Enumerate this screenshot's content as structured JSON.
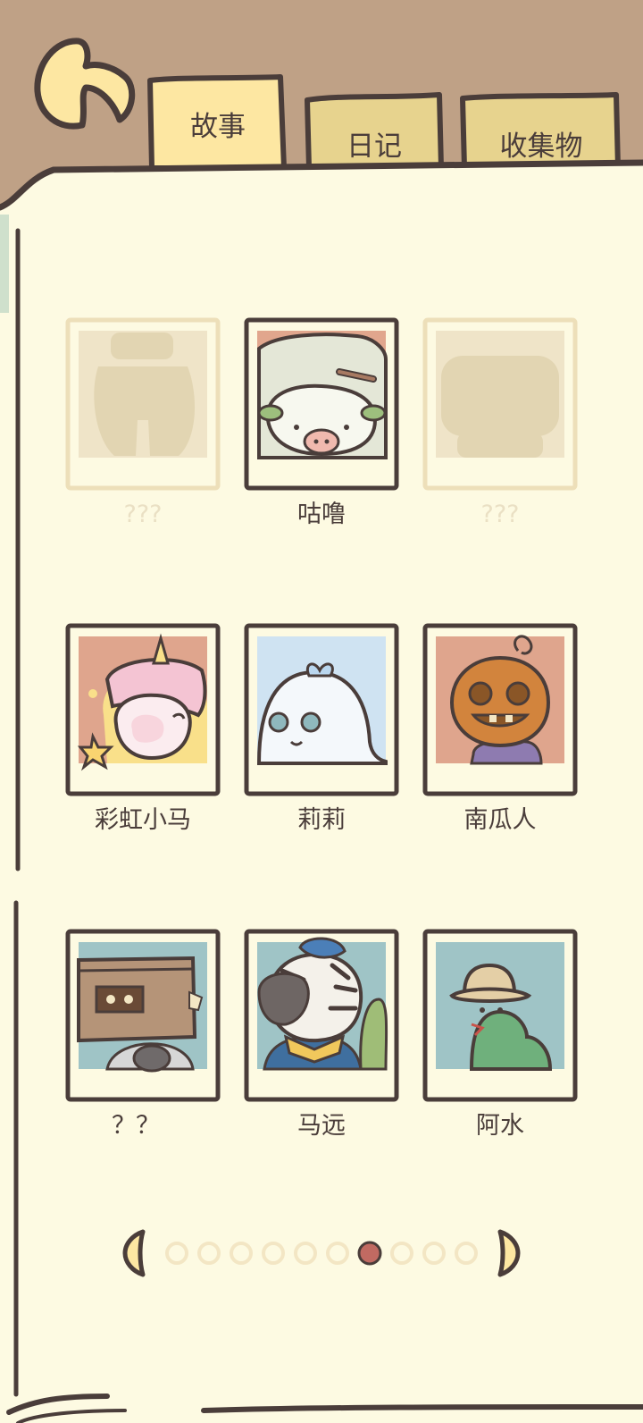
{
  "tabs": [
    {
      "label": "故事",
      "active": true
    },
    {
      "label": "日记",
      "active": false
    },
    {
      "label": "收集物",
      "active": false
    }
  ],
  "characters": [
    {
      "name": "???",
      "icon": "silhouette-jar-icon",
      "locked": true
    },
    {
      "name": "咕噜",
      "icon": "sheep-portrait",
      "locked": false
    },
    {
      "name": "???",
      "icon": "silhouette-blob-icon",
      "locked": true
    },
    {
      "name": "彩虹小马",
      "icon": "unicorn-portrait",
      "locked": false
    },
    {
      "name": "莉莉",
      "icon": "ghost-portrait",
      "locked": false
    },
    {
      "name": "南瓜人",
      "icon": "pumpkin-portrait",
      "locked": false
    },
    {
      "name": "？？",
      "icon": "box-head-portrait",
      "locked": false
    },
    {
      "name": "马远",
      "icon": "zebra-portrait",
      "locked": false
    },
    {
      "name": "阿水",
      "icon": "frog-hat-portrait",
      "locked": false
    }
  ],
  "pagination": {
    "total_pages": 10,
    "current_page": 7
  },
  "colors": {
    "background": "#bfa186",
    "paper": "#fdfae2",
    "outline": "#4a3d3a",
    "tab_active": "#fde7a2",
    "tab_inactive": "#e7d38e",
    "dot_inactive": "#f3e6c4",
    "dot_active": "#c16a62",
    "arrow": "#fde7a2"
  }
}
